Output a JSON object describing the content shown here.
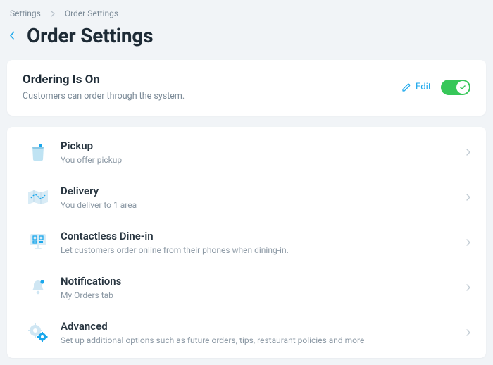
{
  "breadcrumb": {
    "parent": "Settings",
    "current": "Order Settings"
  },
  "page": {
    "title": "Order Settings"
  },
  "status": {
    "title": "Ordering Is On",
    "subtitle": "Customers can order through the system.",
    "edit_label": "Edit",
    "toggle_on": true
  },
  "settings": [
    {
      "icon": "bag",
      "title": "Pickup",
      "subtitle": "You offer pickup"
    },
    {
      "icon": "map",
      "title": "Delivery",
      "subtitle": "You deliver to 1 area"
    },
    {
      "icon": "qr",
      "title": "Contactless Dine-in",
      "subtitle": "Let customers order online from their phones when dining-in."
    },
    {
      "icon": "bell",
      "title": "Notifications",
      "subtitle": "My Orders tab"
    },
    {
      "icon": "gears",
      "title": "Advanced",
      "subtitle": "Set up additional options such as future orders, tips, restaurant policies and more"
    }
  ]
}
